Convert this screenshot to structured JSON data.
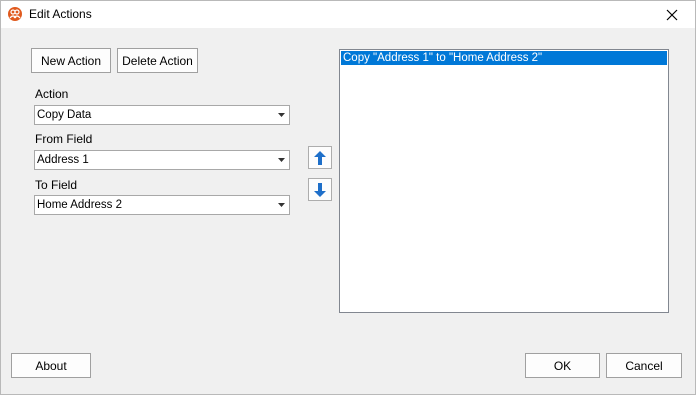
{
  "window": {
    "title": "Edit Actions"
  },
  "toolbar": {
    "new_action": "New Action",
    "delete_action": "Delete Action"
  },
  "form": {
    "action_label": "Action",
    "action_value": "Copy Data",
    "from_label": "From Field",
    "from_value": "Address 1",
    "to_label": "To Field",
    "to_value": "Home Address 2"
  },
  "actions_list": {
    "items": [
      {
        "label": "Copy \"Address 1\" to \"Home Address 2\"",
        "selected": true
      }
    ]
  },
  "footer": {
    "about": "About",
    "ok": "OK",
    "cancel": "Cancel"
  },
  "icons": {
    "app": "people-icon",
    "close": "close-icon",
    "up": "arrow-up-icon",
    "down": "arrow-down-icon",
    "dropdown": "chevron-down-icon"
  },
  "colors": {
    "selection": "#0078d7",
    "accent_arrow": "#1e6fc9",
    "app_icon": "#e05a1e"
  }
}
